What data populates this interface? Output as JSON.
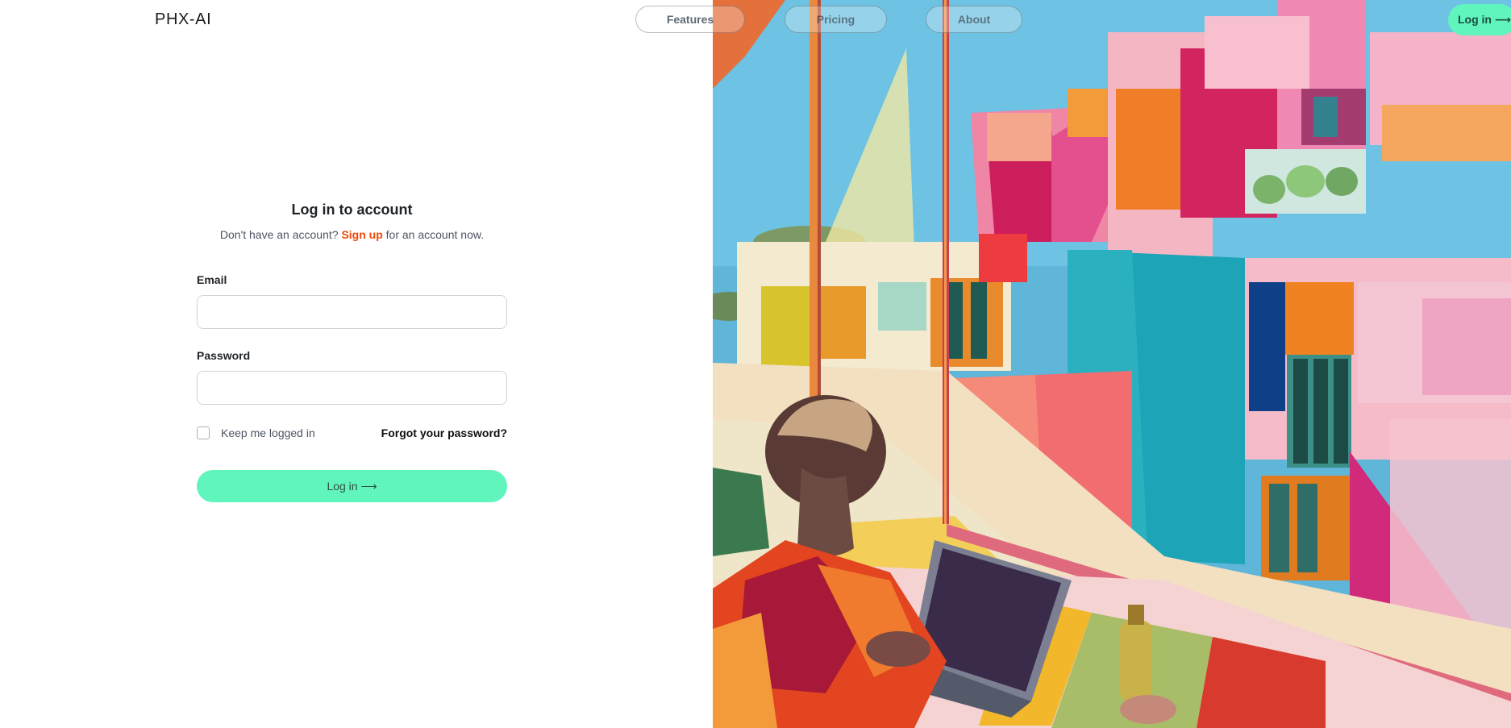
{
  "brand": {
    "name": "PHX-AI"
  },
  "nav": {
    "features": "Features",
    "pricing": "Pricing",
    "about": "About",
    "login": "Log in ⟶"
  },
  "login_form": {
    "title": "Log in to account",
    "subtitle_prefix": "Don't have an account?",
    "signup_link": "Sign up",
    "subtitle_suffix": "for an account now.",
    "email_label": "Email",
    "email_value": "",
    "password_label": "Password",
    "password_value": "",
    "remember_label": "Keep me logged in",
    "remember_checked": false,
    "forgot_link": "Forgot your password?",
    "submit_label": "Log in ⟶"
  },
  "colors": {
    "accent": "#5ff5bd",
    "link": "#ec4a0a"
  },
  "illustration": {
    "icon": "architecture-illustration"
  }
}
